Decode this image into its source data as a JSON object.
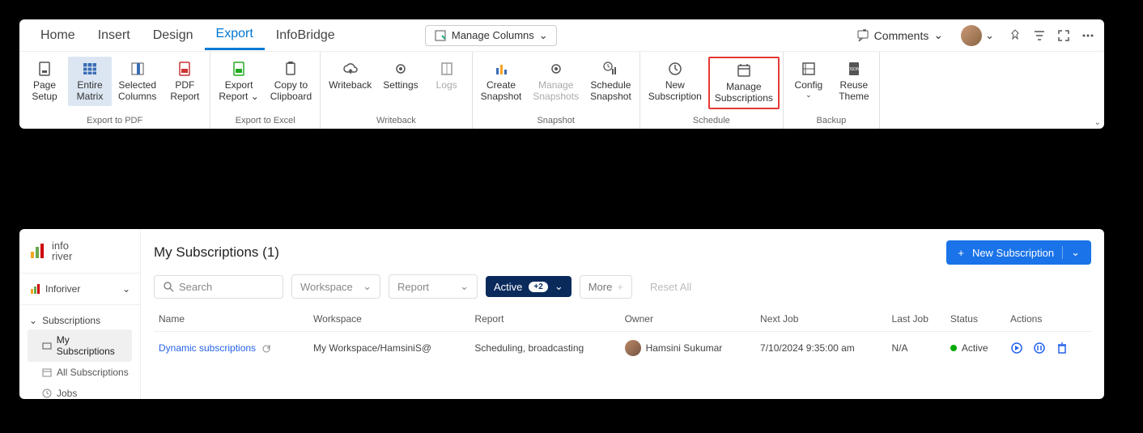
{
  "ribbon": {
    "tabs": [
      "Home",
      "Insert",
      "Design",
      "Export",
      "InfoBridge"
    ],
    "active_tab": 3,
    "manage_columns": "Manage Columns",
    "comments": "Comments",
    "groups": [
      {
        "label": "Export to PDF",
        "items": [
          {
            "l1": "Page",
            "l2": "Setup",
            "icon": "page"
          },
          {
            "l1": "Entire",
            "l2": "Matrix",
            "icon": "grid",
            "sel": true
          },
          {
            "l1": "Selected",
            "l2": "Columns",
            "icon": "cols"
          },
          {
            "l1": "PDF",
            "l2": "Report",
            "icon": "pdf"
          }
        ]
      },
      {
        "label": "Export to Excel",
        "items": [
          {
            "l1": "Export",
            "l2": "Report",
            "icon": "xls",
            "caret": true
          },
          {
            "l1": "Copy to",
            "l2": "Clipboard",
            "icon": "clip"
          }
        ]
      },
      {
        "label": "Writeback",
        "items": [
          {
            "l1": "Writeback",
            "l2": "",
            "icon": "cloud"
          },
          {
            "l1": "Settings",
            "l2": "",
            "icon": "gear"
          },
          {
            "l1": "Logs",
            "l2": "",
            "icon": "book",
            "dis": true
          }
        ]
      },
      {
        "label": "Snapshot",
        "items": [
          {
            "l1": "Create",
            "l2": "Snapshot",
            "icon": "bars"
          },
          {
            "l1": "Manage",
            "l2": "Snapshots",
            "icon": "gear2",
            "dis": true
          },
          {
            "l1": "Schedule",
            "l2": "Snapshot",
            "icon": "clockbar"
          }
        ]
      },
      {
        "label": "Schedule",
        "items": [
          {
            "l1": "New",
            "l2": "Subscription",
            "icon": "clockplus"
          },
          {
            "l1": "Manage",
            "l2": "Subscriptions",
            "icon": "cal",
            "hl": true
          }
        ]
      },
      {
        "label": "Backup",
        "items": [
          {
            "l1": "Config",
            "l2": "",
            "icon": "config",
            "caret": true
          },
          {
            "l1": "Reuse",
            "l2": "Theme",
            "icon": "json"
          }
        ]
      }
    ]
  },
  "subs": {
    "logo1": "info",
    "logo2": "river",
    "workspace_name": "Inforiver",
    "section": "Subscriptions",
    "items": [
      "My Subscriptions",
      "All Subscriptions",
      "Jobs"
    ],
    "active_item": 0,
    "title": "My Subscriptions (1)",
    "new_btn": "New Subscription",
    "search_ph": "Search",
    "workspace_ph": "Workspace",
    "report_ph": "Report",
    "status_label": "Active",
    "status_count": "+2",
    "more": "More",
    "reset": "Reset All",
    "columns": [
      "Name",
      "Workspace",
      "Report",
      "Owner",
      "Next Job",
      "Last Job",
      "Status",
      "Actions"
    ],
    "row": {
      "name": "Dynamic subscriptions",
      "workspace": "My Workspace/HamsiniS@",
      "report": "Scheduling, broadcasting",
      "owner": "Hamsini Sukumar",
      "next": "7/10/2024 9:35:00 am",
      "last": "N/A",
      "status": "Active"
    }
  }
}
